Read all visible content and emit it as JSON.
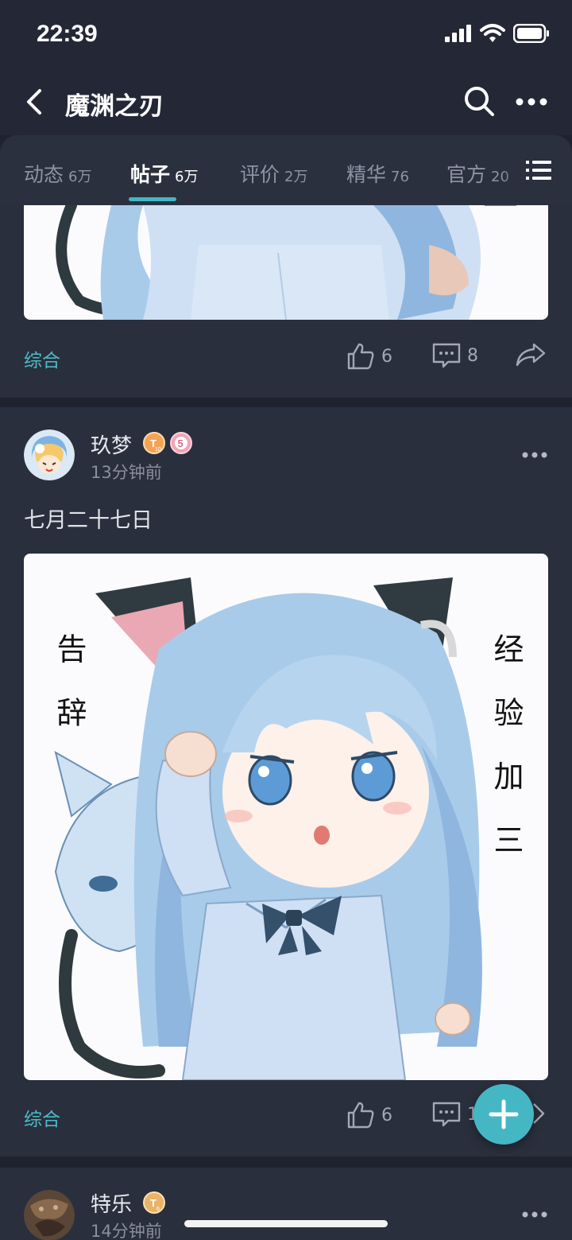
{
  "status": {
    "time": "22:39"
  },
  "header": {
    "title": "魔渊之刃"
  },
  "tabs": [
    {
      "label": "动态",
      "count": "6万"
    },
    {
      "label": "帖子",
      "count": "6万"
    },
    {
      "label": "评价",
      "count": "2万"
    },
    {
      "label": "精华",
      "count": "76"
    },
    {
      "label": "官方",
      "count": "20"
    }
  ],
  "posts": [
    {
      "category": "综合",
      "likes": "6",
      "comments": "8"
    },
    {
      "user": "玖梦",
      "level_badge": "T10",
      "rank_badge": "5",
      "time": "13分钟前",
      "text": "七月二十七日",
      "image_caption_left": "告辞",
      "image_caption_right": "经验加三",
      "category": "综合",
      "likes": "6",
      "comments": "1"
    },
    {
      "user": "特乐",
      "level_badge": "T6",
      "time": "14分钟前"
    }
  ],
  "colors": {
    "accent": "#45b7c4",
    "background": "#1f2330",
    "card": "#2a2f3d"
  }
}
